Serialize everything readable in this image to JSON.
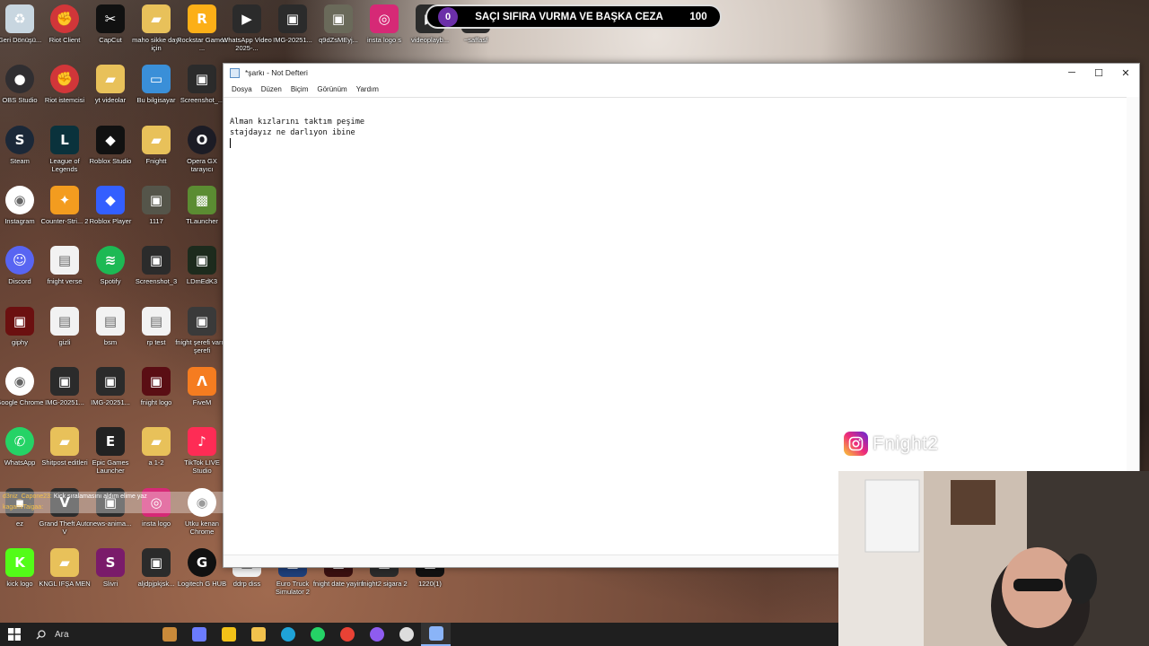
{
  "desktop_icons": [
    {
      "label": "Geri Dönüşü...",
      "icon": "recycle-bin-icon",
      "color": "#c8d6e0",
      "glyph": "♻"
    },
    {
      "label": "OBS Studio",
      "icon": "obs-icon",
      "color": "#302e31",
      "glyph": "●"
    },
    {
      "label": "Steam",
      "icon": "steam-icon",
      "color": "#1b2838",
      "glyph": "S"
    },
    {
      "label": "Instagram",
      "icon": "chrome-icon",
      "color": "#ffffff",
      "glyph": "◉"
    },
    {
      "label": "Discord",
      "icon": "discord-icon",
      "color": "#5865f2",
      "glyph": "☺"
    },
    {
      "label": "giphy",
      "icon": "giphy-icon",
      "color": "#6b1010",
      "glyph": "▣"
    },
    {
      "label": "Google Chrome",
      "icon": "chrome-icon",
      "color": "#ffffff",
      "glyph": "◉"
    },
    {
      "label": "WhatsApp",
      "icon": "whatsapp-icon",
      "color": "#25d366",
      "glyph": "✆"
    },
    {
      "label": "ez",
      "icon": "app-icon",
      "color": "#333333",
      "glyph": "▪"
    },
    {
      "label": "kick logo",
      "icon": "kick-icon",
      "color": "#53fc18",
      "glyph": "K"
    },
    {
      "label": "Riot Client",
      "icon": "riot-icon",
      "color": "#d13639",
      "glyph": "✊"
    },
    {
      "label": "Riot istemcisi",
      "icon": "riot-icon",
      "color": "#d13639",
      "glyph": "✊"
    },
    {
      "label": "League of Legends",
      "icon": "lol-icon",
      "color": "#0a323c",
      "glyph": "L"
    },
    {
      "label": "Counter-Stri... 2",
      "icon": "cs2-icon",
      "color": "#f39c1f",
      "glyph": "✦"
    },
    {
      "label": "fnight verse",
      "icon": "document-icon",
      "color": "#f2f2f2",
      "glyph": "▤"
    },
    {
      "label": "gizli",
      "icon": "document-icon",
      "color": "#f2f2f2",
      "glyph": "▤"
    },
    {
      "label": "IMG-20251...",
      "icon": "image-icon",
      "color": "#2b2b2b",
      "glyph": "▣"
    },
    {
      "label": "Shitpost editleri",
      "icon": "folder-icon",
      "color": "#e8c15a",
      "glyph": "▰"
    },
    {
      "label": "Grand Theft Auto V",
      "icon": "gta-icon",
      "color": "#2c2c2c",
      "glyph": "V"
    },
    {
      "label": "KNGL IFŞA MEN",
      "icon": "folder-icon",
      "color": "#e8c15a",
      "glyph": "▰"
    },
    {
      "label": "CapCut",
      "icon": "capcut-icon",
      "color": "#111111",
      "glyph": "✂"
    },
    {
      "label": "yt videolar",
      "icon": "folder-icon",
      "color": "#e8c15a",
      "glyph": "▰"
    },
    {
      "label": "Roblox Studio",
      "icon": "roblox-icon",
      "color": "#111111",
      "glyph": "◆"
    },
    {
      "label": "Roblox Player",
      "icon": "roblox-icon",
      "color": "#335fff",
      "glyph": "◆"
    },
    {
      "label": "Spotify",
      "icon": "spotify-icon",
      "color": "#1db954",
      "glyph": "≋"
    },
    {
      "label": "bsm",
      "icon": "document-icon",
      "color": "#f2f2f2",
      "glyph": "▤"
    },
    {
      "label": "IMG-20251...",
      "icon": "image-icon",
      "color": "#2b2b2b",
      "glyph": "▣"
    },
    {
      "label": "Epic Games Launcher",
      "icon": "epic-icon",
      "color": "#222222",
      "glyph": "E"
    },
    {
      "label": "news-anima...",
      "icon": "image-icon",
      "color": "#2b2b2b",
      "glyph": "▣"
    },
    {
      "label": "Slivri",
      "icon": "app-icon",
      "color": "#7a1b6a",
      "glyph": "S"
    },
    {
      "label": "maho sikke dayi için",
      "icon": "folder-icon",
      "color": "#e8c15a",
      "glyph": "▰"
    },
    {
      "label": "Bu bilgisayar",
      "icon": "computer-icon",
      "color": "#3a8fd8",
      "glyph": "▭"
    },
    {
      "label": "Fnightt",
      "icon": "folder-icon",
      "color": "#e8c15a",
      "glyph": "▰"
    },
    {
      "label": "1117",
      "icon": "image-icon",
      "color": "#55554a",
      "glyph": "▣"
    },
    {
      "label": "Screenshot_3",
      "icon": "image-icon",
      "color": "#2b2b2b",
      "glyph": "▣"
    },
    {
      "label": "rp test",
      "icon": "document-icon",
      "color": "#f2f2f2",
      "glyph": "▤"
    },
    {
      "label": "fnight logo",
      "icon": "image-icon",
      "color": "#5a0e14",
      "glyph": "▣"
    },
    {
      "label": "a 1-2",
      "icon": "folder-icon",
      "color": "#e8c15a",
      "glyph": "▰"
    },
    {
      "label": "insta logo",
      "icon": "instagram-icon",
      "color": "#d62976",
      "glyph": "◎"
    },
    {
      "label": "aljdpjpkjsk...",
      "icon": "image-icon",
      "color": "#2b2b2b",
      "glyph": "▣"
    },
    {
      "label": "Rockstar Games ...",
      "icon": "rockstar-icon",
      "color": "#fcaf17",
      "glyph": "R"
    },
    {
      "label": "Screenshot_...",
      "icon": "image-icon",
      "color": "#2b2b2b",
      "glyph": "▣"
    },
    {
      "label": "Opera GX tarayıcı",
      "icon": "opera-icon",
      "color": "#1c1c25",
      "glyph": "O"
    },
    {
      "label": "TLauncher",
      "icon": "minecraft-icon",
      "color": "#5b8c32",
      "glyph": "▩"
    },
    {
      "label": "LDmEdK3",
      "icon": "image-icon",
      "color": "#1d2b1d",
      "glyph": "▣"
    },
    {
      "label": "fnight şerefi varmı şerefi",
      "icon": "image-icon",
      "color": "#3a3a3a",
      "glyph": "▣"
    },
    {
      "label": "FiveM",
      "icon": "fivem-icon",
      "color": "#f57c20",
      "glyph": "Λ"
    },
    {
      "label": "TikTok LIVE Studio",
      "icon": "tiktok-icon",
      "color": "#fe2c55",
      "glyph": "♪"
    },
    {
      "label": "Utku kenan Chrome",
      "icon": "chrome-icon",
      "color": "#ffffff",
      "glyph": "◉"
    },
    {
      "label": "Logitech G HUB",
      "icon": "logitech-icon",
      "color": "#111111",
      "glyph": "G"
    },
    {
      "label": "WhatsApp Video 2025-...",
      "icon": "video-icon",
      "color": "#2b2b2b",
      "glyph": "▶"
    },
    {
      "label": "IMG-20251...",
      "icon": "image-icon",
      "color": "#2b2b2b",
      "glyph": "▣"
    },
    {
      "label": "q9dZsMEyj...",
      "icon": "image-icon",
      "color": "#6a6a5a",
      "glyph": "▣"
    },
    {
      "label": "insta logo s",
      "icon": "instagram-icon",
      "color": "#d62976",
      "glyph": "◎"
    },
    {
      "label": "videoplayb...",
      "icon": "video-icon",
      "color": "#2b2b2b",
      "glyph": "▶"
    },
    {
      "label": "~saffasf",
      "icon": "document-icon",
      "color": "#2b2b2b",
      "glyph": "▤"
    },
    {
      "label": "ddrp diss",
      "icon": "document-icon",
      "color": "#f2f2f2",
      "glyph": "▤"
    },
    {
      "label": "Euro Truck Simulator 2",
      "icon": "ets2-icon",
      "color": "#1e3f7a",
      "glyph": "▲"
    },
    {
      "label": "fnight date yayini",
      "icon": "image-icon",
      "color": "#3a1010",
      "glyph": "▣"
    },
    {
      "label": "fnight2 sigara 2",
      "icon": "image-icon",
      "color": "#2b2b2b",
      "glyph": "▣"
    },
    {
      "label": "1220(1)",
      "icon": "image-icon",
      "color": "#111111",
      "glyph": "▣"
    }
  ],
  "goal_bar": {
    "left_count": "0",
    "text": "SAÇI SIFIRA VURMA VE BAŞKA CEZA",
    "right_count": "100",
    "accent": "#6b2fa8"
  },
  "notepad": {
    "title": "*şarkı - Not Defteri",
    "menus": [
      "Dosya",
      "Düzen",
      "Biçim",
      "Görünüm",
      "Yardım"
    ],
    "lines": [
      "Alman kızlarını taktım peşime",
      "stajdayız ne darlıyon ibine"
    ],
    "controls": {
      "minimize": "─",
      "maximize": "☐",
      "close": "✕"
    }
  },
  "chat": [
    {
      "user": "d3niz_Capone23:",
      "message": "Kick sıralamasını aldım elime yaz"
    },
    {
      "user": "kagamiTaigaa:",
      "message": ""
    }
  ],
  "instagram_tag": {
    "handle": "Fnight2"
  },
  "taskbar": {
    "search_placeholder": "Ara",
    "apps": [
      {
        "name": "widgets-icon",
        "color": "#c98a3a"
      },
      {
        "name": "copilot-icon",
        "color": "#6b7cff"
      },
      {
        "name": "store-icon",
        "color": "#f2c218"
      },
      {
        "name": "explorer-icon",
        "color": "#f2c24d"
      },
      {
        "name": "edge-icon",
        "color": "#1fa3d8"
      },
      {
        "name": "whatsapp-icon",
        "color": "#25d366"
      },
      {
        "name": "chrome-icon",
        "color": "#e94235"
      },
      {
        "name": "discord-icon",
        "color": "#8e5cf0"
      },
      {
        "name": "obs-icon",
        "color": "#dddddd"
      },
      {
        "name": "notepad-icon",
        "color": "#8ab4f8"
      }
    ]
  }
}
